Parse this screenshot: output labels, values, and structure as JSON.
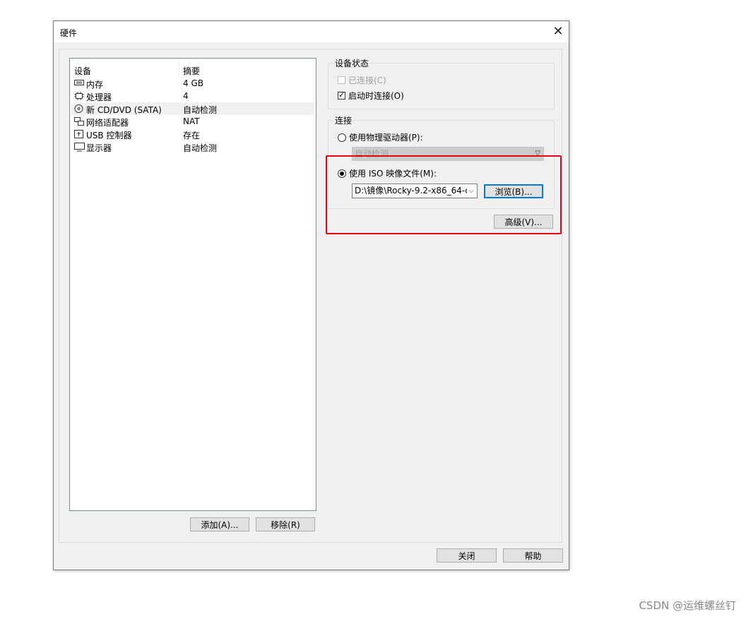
{
  "window": {
    "title": "硬件",
    "close_glyph": "✕"
  },
  "device_list": {
    "headers": {
      "device": "设备",
      "summary": "摘要"
    },
    "items": [
      {
        "icon": "memory-icon",
        "name": "内存",
        "summary": "4 GB",
        "selected": false
      },
      {
        "icon": "processor-icon",
        "name": "处理器",
        "summary": "4",
        "selected": false
      },
      {
        "icon": "cd-dvd-icon",
        "name": "新 CD/DVD (SATA)",
        "summary": "自动检测",
        "selected": true
      },
      {
        "icon": "network-adapter-icon",
        "name": "网络适配器",
        "summary": "NAT",
        "selected": false
      },
      {
        "icon": "usb-controller-icon",
        "name": "USB 控制器",
        "summary": "存在",
        "selected": false
      },
      {
        "icon": "display-icon",
        "name": "显示器",
        "summary": "自动检测",
        "selected": false
      }
    ],
    "add_button": "添加(A)...",
    "remove_button": "移除(R)"
  },
  "device_status": {
    "label": "设备状态",
    "connected": {
      "label": "已连接(C)",
      "checked": false,
      "enabled": false
    },
    "connect_at_power_on": {
      "label": "启动时连接(O)",
      "checked": true,
      "enabled": true
    }
  },
  "connection": {
    "label": "连接",
    "physical_drive": {
      "label": "使用物理驱动器(P):",
      "selected": false,
      "value": "自动检测"
    },
    "iso_image": {
      "label": "使用 ISO 映像文件(M):",
      "selected": true,
      "path": "D:\\镜像\\Rocky-9.2-x86_64-c"
    },
    "browse_button": "浏览(B)...",
    "advanced_button": "高级(V)..."
  },
  "footer": {
    "close_button": "关闭",
    "help_button": "帮助"
  },
  "watermark": "CSDN @运维螺丝钉",
  "colors": {
    "highlight": "#e60012",
    "focus": "#0078d7"
  }
}
